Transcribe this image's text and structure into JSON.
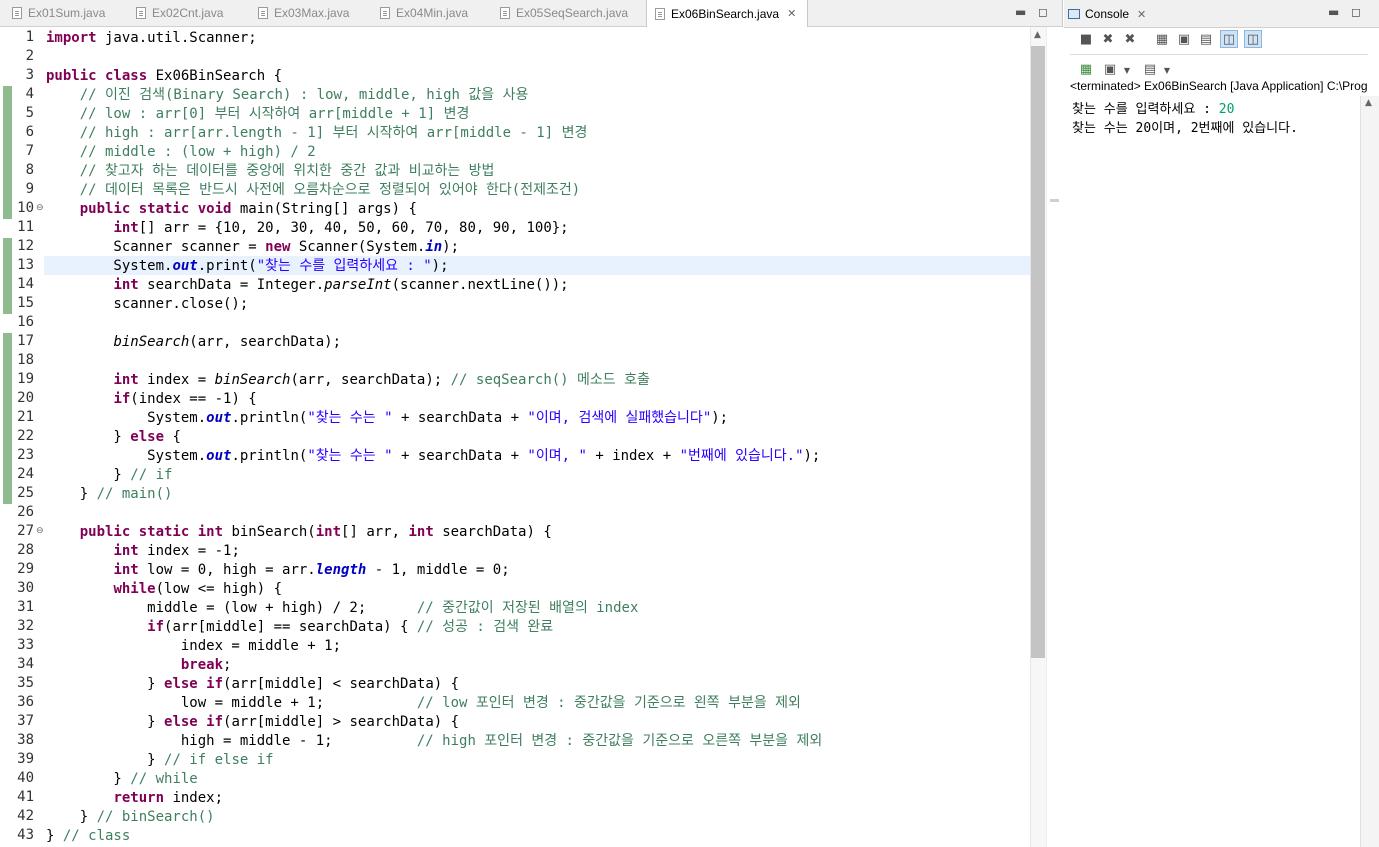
{
  "tabs": [
    {
      "label": "Ex01Sum.java",
      "active": false
    },
    {
      "label": "Ex02Cnt.java",
      "active": false
    },
    {
      "label": "Ex03Max.java",
      "active": false
    },
    {
      "label": "Ex04Min.java",
      "active": false
    },
    {
      "label": "Ex05SeqSearch.java",
      "active": false
    },
    {
      "label": "Ex06BinSearch.java",
      "active": true
    }
  ],
  "editor": {
    "current_line": 13,
    "lines": [
      [
        {
          "t": "import",
          "c": "kw"
        },
        {
          "t": " java.util.Scanner;"
        }
      ],
      [],
      [
        {
          "t": "public class",
          "c": "kw"
        },
        {
          "t": " Ex06BinSearch {"
        }
      ],
      [
        {
          "t": "    "
        },
        {
          "t": "// 이진 검색(Binary Search) : low, middle, high 값을 사용",
          "c": "cm"
        }
      ],
      [
        {
          "t": "    "
        },
        {
          "t": "// low : arr[0] 부터 시작하여 arr[middle + 1] 변경",
          "c": "cm"
        }
      ],
      [
        {
          "t": "    "
        },
        {
          "t": "// high : arr[arr.length - 1] 부터 시작하여 arr[middle - 1] 변경",
          "c": "cm"
        }
      ],
      [
        {
          "t": "    "
        },
        {
          "t": "// middle : (low + high) / 2",
          "c": "cm"
        }
      ],
      [
        {
          "t": "    "
        },
        {
          "t": "// 찾고자 하는 데이터를 중앙에 위치한 중간 값과 비교하는 방법",
          "c": "cm"
        }
      ],
      [
        {
          "t": "    "
        },
        {
          "t": "// 데이터 목록은 반드시 사전에 오름차순으로 정렬되어 있어야 한다(전제조건)",
          "c": "cm"
        }
      ],
      [
        {
          "t": "    "
        },
        {
          "t": "public static void",
          "c": "kw"
        },
        {
          "t": " main(String[] args) {"
        }
      ],
      [
        {
          "t": "        "
        },
        {
          "t": "int",
          "c": "kw"
        },
        {
          "t": "[] arr = {10, 20, 30, 40, 50, 60, 70, 80, 90, 100};"
        }
      ],
      [
        {
          "t": "        Scanner scanner = "
        },
        {
          "t": "new",
          "c": "kw"
        },
        {
          "t": " Scanner(System."
        },
        {
          "t": "in",
          "c": "fld"
        },
        {
          "t": ");"
        }
      ],
      [
        {
          "t": "        System."
        },
        {
          "t": "out",
          "c": "fld"
        },
        {
          "t": ".print("
        },
        {
          "t": "\"찾는 수를 입력하세요 : \"",
          "c": "st"
        },
        {
          "t": ");"
        }
      ],
      [
        {
          "t": "        "
        },
        {
          "t": "int",
          "c": "kw"
        },
        {
          "t": " searchData = Integer."
        },
        {
          "t": "parseInt",
          "c": "it"
        },
        {
          "t": "(scanner.nextLine());"
        }
      ],
      [
        {
          "t": "        scanner.close();"
        }
      ],
      [],
      [
        {
          "t": "        "
        },
        {
          "t": "binSearch",
          "c": "it"
        },
        {
          "t": "(arr, searchData);"
        }
      ],
      [],
      [
        {
          "t": "        "
        },
        {
          "t": "int",
          "c": "kw"
        },
        {
          "t": " index = "
        },
        {
          "t": "binSearch",
          "c": "it"
        },
        {
          "t": "(arr, searchData); "
        },
        {
          "t": "// seqSearch() 메소드 호출",
          "c": "cm"
        }
      ],
      [
        {
          "t": "        "
        },
        {
          "t": "if",
          "c": "kw"
        },
        {
          "t": "(index == -1) {"
        }
      ],
      [
        {
          "t": "            System."
        },
        {
          "t": "out",
          "c": "fld"
        },
        {
          "t": ".println("
        },
        {
          "t": "\"찾는 수는 \"",
          "c": "st"
        },
        {
          "t": " + searchData + "
        },
        {
          "t": "\"이며, 검색에 실패했습니다\"",
          "c": "st"
        },
        {
          "t": ");"
        }
      ],
      [
        {
          "t": "        } "
        },
        {
          "t": "else",
          "c": "kw"
        },
        {
          "t": " {"
        }
      ],
      [
        {
          "t": "            System."
        },
        {
          "t": "out",
          "c": "fld"
        },
        {
          "t": ".println("
        },
        {
          "t": "\"찾는 수는 \"",
          "c": "st"
        },
        {
          "t": " + searchData + "
        },
        {
          "t": "\"이며, \"",
          "c": "st"
        },
        {
          "t": " + index + "
        },
        {
          "t": "\"번째에 있습니다.\"",
          "c": "st"
        },
        {
          "t": ");"
        }
      ],
      [
        {
          "t": "        } "
        },
        {
          "t": "// if",
          "c": "cm"
        }
      ],
      [
        {
          "t": "    } "
        },
        {
          "t": "// main()",
          "c": "cm"
        }
      ],
      [],
      [
        {
          "t": "    "
        },
        {
          "t": "public static int",
          "c": "kw"
        },
        {
          "t": " binSearch("
        },
        {
          "t": "int",
          "c": "kw"
        },
        {
          "t": "[] arr, "
        },
        {
          "t": "int",
          "c": "kw"
        },
        {
          "t": " searchData) {"
        }
      ],
      [
        {
          "t": "        "
        },
        {
          "t": "int",
          "c": "kw"
        },
        {
          "t": " index = -1;"
        }
      ],
      [
        {
          "t": "        "
        },
        {
          "t": "int",
          "c": "kw"
        },
        {
          "t": " low = 0, high = arr."
        },
        {
          "t": "length",
          "c": "fld"
        },
        {
          "t": " - 1, middle = 0;"
        }
      ],
      [
        {
          "t": "        "
        },
        {
          "t": "while",
          "c": "kw"
        },
        {
          "t": "(low <= high) {"
        }
      ],
      [
        {
          "t": "            middle = (low + high) / 2;      "
        },
        {
          "t": "// 중간값이 저장된 배열의 index",
          "c": "cm"
        }
      ],
      [
        {
          "t": "            "
        },
        {
          "t": "if",
          "c": "kw"
        },
        {
          "t": "(arr[middle] == searchData) { "
        },
        {
          "t": "// 성공 : 검색 완료",
          "c": "cm"
        }
      ],
      [
        {
          "t": "                index = middle + 1;"
        }
      ],
      [
        {
          "t": "                "
        },
        {
          "t": "break",
          "c": "kw"
        },
        {
          "t": ";"
        }
      ],
      [
        {
          "t": "            } "
        },
        {
          "t": "else if",
          "c": "kw"
        },
        {
          "t": "(arr[middle] < searchData) {"
        }
      ],
      [
        {
          "t": "                low = middle + 1;           "
        },
        {
          "t": "// low 포인터 변경 : 중간값을 기준으로 왼쪽 부분을 제외",
          "c": "cm"
        }
      ],
      [
        {
          "t": "            } "
        },
        {
          "t": "else if",
          "c": "kw"
        },
        {
          "t": "(arr[middle] > searchData) {"
        }
      ],
      [
        {
          "t": "                high = middle - 1;          "
        },
        {
          "t": "// high 포인터 변경 : 중간값을 기준으로 오른쪽 부분을 제외",
          "c": "cm"
        }
      ],
      [
        {
          "t": "            } "
        },
        {
          "t": "// if else if",
          "c": "cm"
        }
      ],
      [
        {
          "t": "        } "
        },
        {
          "t": "// while",
          "c": "cm"
        }
      ],
      [
        {
          "t": "        "
        },
        {
          "t": "return",
          "c": "kw"
        },
        {
          "t": " index;"
        }
      ],
      [
        {
          "t": "    } "
        },
        {
          "t": "// binSearch()",
          "c": "cm"
        }
      ],
      [
        {
          "t": "} "
        },
        {
          "t": "// class",
          "c": "cm"
        }
      ]
    ]
  },
  "console": {
    "tab_label": "Console",
    "process_title": "<terminated> Ex06BinSearch [Java Application] C:\\Prog",
    "output": [
      [
        {
          "t": "찾는 수를 입력하세요 : ",
          "color": "#000000"
        },
        {
          "t": "20",
          "color": "#00a070"
        }
      ],
      [
        {
          "t": "찾는 수는 20이며, 2번째에 있습니다.",
          "color": "#000000"
        }
      ]
    ]
  },
  "colors": {
    "keyword": "#7f0055",
    "comment": "#3f7f5f",
    "string": "#2a00ff",
    "field": "#0000c0",
    "current_line": "#e8f2fe",
    "change_bar": "#8fbc8f"
  }
}
